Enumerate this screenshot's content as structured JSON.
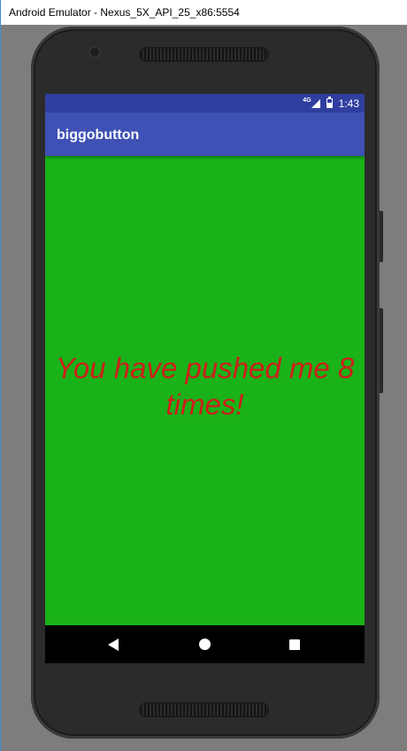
{
  "window": {
    "title": "Android Emulator - Nexus_5X_API_25_x86:5554"
  },
  "status_bar": {
    "network_label": "4G",
    "time": "1:43",
    "icons": [
      "signal-icon",
      "battery-icon"
    ]
  },
  "app_bar": {
    "title": "biggobutton"
  },
  "content": {
    "message": "You have pushed me 8 times!",
    "push_count": 8
  },
  "nav_bar": {
    "icons": [
      "back-icon",
      "home-icon",
      "recents-icon"
    ]
  },
  "colors": {
    "status_bar": "#303f9f",
    "app_bar": "#3f51b5",
    "content_background": "#19b219",
    "message_text": "#cc1f1a"
  }
}
